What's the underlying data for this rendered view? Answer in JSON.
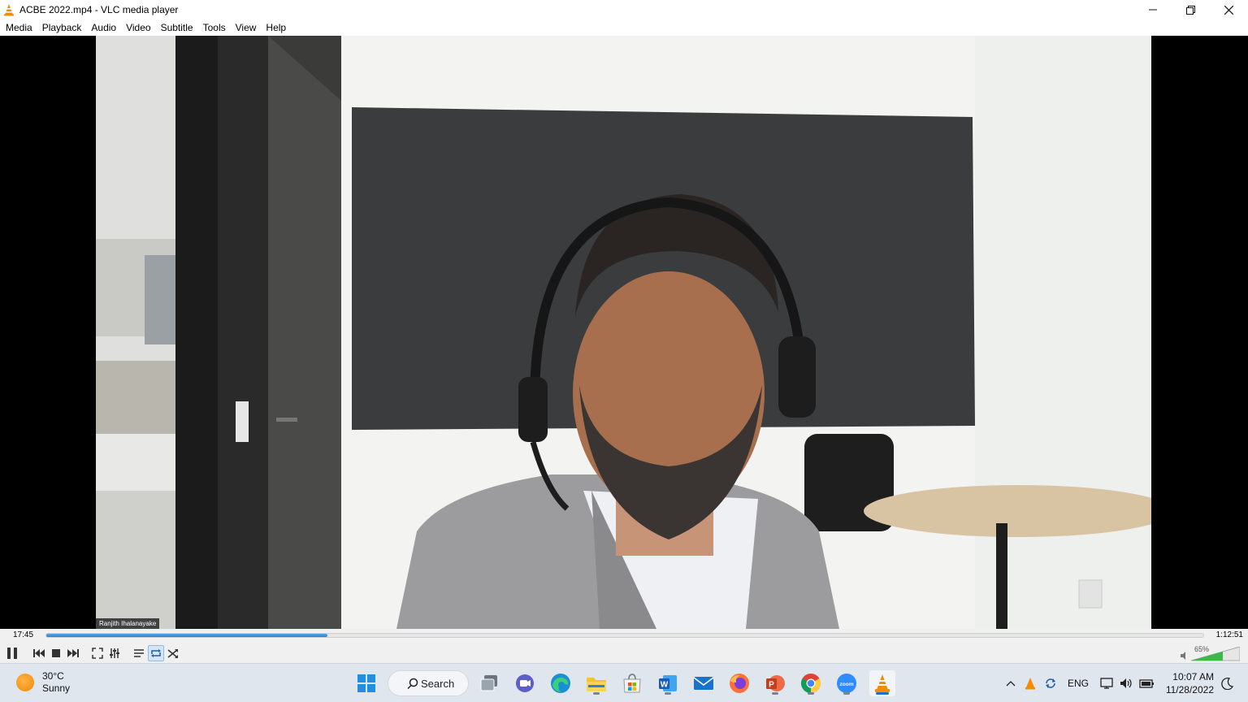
{
  "window": {
    "title": "ACBE 2022.mp4 - VLC media player",
    "controls": [
      "minimize",
      "restore",
      "close"
    ]
  },
  "menu": [
    "Media",
    "Playback",
    "Audio",
    "Video",
    "Subtitle",
    "Tools",
    "View",
    "Help"
  ],
  "video": {
    "participant_name": "Ranjith Ihalanayake"
  },
  "playback": {
    "elapsed": "17:45",
    "total": "1:12:51",
    "progress_fraction": 0.243,
    "volume_label": "65%",
    "volume_fraction": 0.65,
    "loop_active": true
  },
  "taskbar": {
    "weather": {
      "temp": "30°C",
      "condition": "Sunny"
    },
    "search_label": "Search",
    "pinned_apps": [
      "windows-start",
      "search",
      "task-view",
      "teams-chat",
      "edge",
      "file-explorer",
      "microsoft-store",
      "word",
      "mail",
      "firefox",
      "powerpoint",
      "chrome",
      "zoom",
      "vlc"
    ],
    "language": "ENG",
    "time": "10:07 AM",
    "date": "11/28/2022"
  },
  "colors": {
    "seek_fill": "#2f7fcf",
    "taskbar_bg": "#dfe6ee",
    "vlc_orange": "#f28c00"
  }
}
